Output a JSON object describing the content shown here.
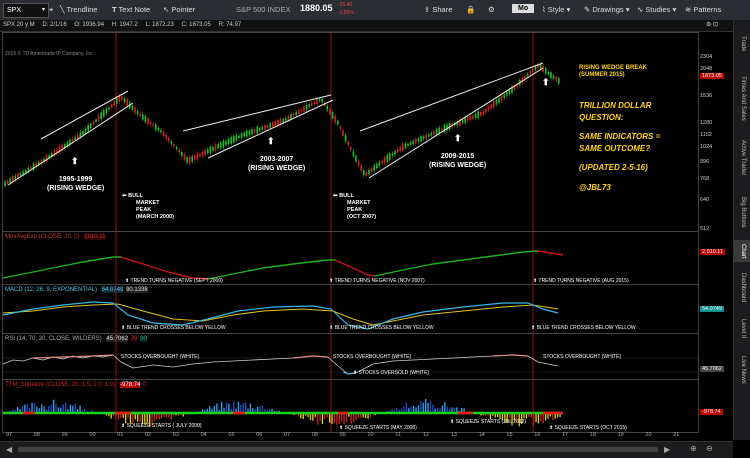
{
  "toolbar": {
    "symbol": "SPX",
    "index_name": "S&P 500 INDEX",
    "price": "1880.05",
    "change_top": "-35.40",
    "change_pct": "-1.85%",
    "tools": [
      "Trendline",
      "Text Note",
      "Pointer"
    ],
    "share": "Share",
    "mo": "Mo",
    "style": "Style",
    "drawings": "Drawings",
    "studies": "Studies",
    "patterns": "Patterns"
  },
  "infobar": {
    "chart_id": "SPX 20 y M",
    "date": "D: 2/1/16",
    "open": "O: 1936.94",
    "high": "H: 1947.2",
    "low": "L: 1872.23",
    "close": "C: 1873.05",
    "range": "R: 74.97"
  },
  "copyright": "2015 © TD Ameritrade IP Company, Inc.",
  "annotations": {
    "w1": [
      "1995-1999",
      "(RISING WEDGE)"
    ],
    "w2": [
      "2003-2007",
      "(RISING WEDGE)"
    ],
    "w3": [
      "2009-2015",
      "(RISING WEDGE)"
    ],
    "peak1": [
      "BULL",
      "MARKET",
      "PEAK",
      "(MARCH 2000)"
    ],
    "peak2": [
      "BULL",
      "MARKET",
      "PEAK",
      "(OCT 2007)"
    ],
    "break": [
      "RISING WEDGE BREAK",
      "(SUMMER 2015)"
    ],
    "question": [
      "TRILLION DOLLAR",
      "QUESTION:",
      "SAME INDICATORS =",
      "SAME OUTCOME?",
      "(UPDATED 2-5-16)",
      "@JBL73"
    ]
  },
  "price_axis": [
    "2304",
    "2048",
    "1873.05",
    "1536",
    "1280",
    "1152",
    "1024",
    "896",
    "768",
    "640",
    "512"
  ],
  "panes": {
    "ma": {
      "title": "MovAvgExp (CLOSE, 20, 0)",
      "value": "2010.11",
      "axis": [
        "2,010.11"
      ],
      "notes": [
        "TREND TURNS NEGATIVE (SEPT 2000)",
        "TREND TURNS NEGATIVE (NOV 2007)",
        "TREND TURNS NEGATIVE (AUG 2015)"
      ]
    },
    "macd": {
      "title": "MACD (12, 26, 9, EXPONENTIAL)",
      "v1": "54.0749",
      "v2": "90.1338",
      "axis": [
        "54.0749"
      ],
      "notes": [
        "BLUE TREND CROSSES BELOW YELLOW",
        "BLUE TREND CROSSES BELOW  YELLOW",
        "BLUE TREND CROSSES BELOW YELLOW"
      ]
    },
    "rsi": {
      "title": "RSI (14, 70, 30, CLOSE, WILDERS)",
      "v1": "45.7062",
      "v2": "70",
      "v3": "30",
      "axis": [
        "45.7062"
      ],
      "notes": [
        "STOCKS OVERBOUGHT (WHITE)",
        "STOCKS OVERBOUGHT (WHITE)",
        "STOCKS OVERBOUGHT (WHITE)",
        "STOCKS OVERSOLD (WHITE)"
      ]
    },
    "ttm": {
      "title": "TTM_Squeeze (CLOSE, 20, 1.5, 2.0, 1.0)",
      "v1": "-978.74",
      "v2": "0",
      "axis": [
        "-978.74"
      ],
      "notes": [
        "SQUEEZE STARTS ( JULY 2000)",
        "SQUEEZE STARTS (MAY 2008)",
        "SQUEEZE STARTS (JUL 2012)",
        "SQUEEZE STARTS (OCT 2015)"
      ]
    }
  },
  "x_axis": [
    "97",
    "98",
    "99",
    "00",
    "01",
    "02",
    "03",
    "04",
    "05",
    "06",
    "07",
    "08",
    "09",
    "10",
    "11",
    "12",
    "13",
    "14",
    "15",
    "16",
    "17",
    "18",
    "19",
    "20",
    "21"
  ],
  "sidebar": [
    "Trade",
    "Times And Sales",
    "Active Trader",
    "Big Buttons",
    "Chart",
    "Dashboard",
    "Level II",
    "Live News"
  ]
}
